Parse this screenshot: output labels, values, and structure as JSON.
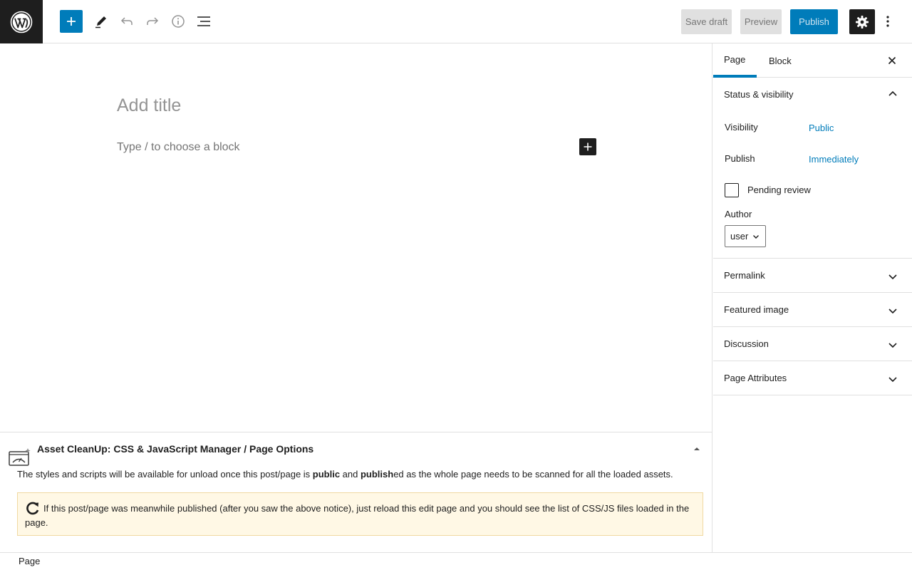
{
  "toolbar": {
    "save_draft_label": "Save draft",
    "preview_label": "Preview",
    "publish_label": "Publish"
  },
  "editor": {
    "title_placeholder": "Add title",
    "block_placeholder": "Type / to choose a block"
  },
  "sidebar": {
    "tabs": [
      {
        "label": "Page",
        "active": true
      },
      {
        "label": "Block",
        "active": false
      }
    ],
    "status_visibility": {
      "heading": "Status & visibility",
      "visibility_label": "Visibility",
      "visibility_value": "Public",
      "publish_label": "Publish",
      "publish_value": "Immediately",
      "pending_review_label": "Pending review",
      "author_label": "Author",
      "author_value": "user"
    },
    "panels": [
      {
        "heading": "Permalink"
      },
      {
        "heading": "Featured image"
      },
      {
        "heading": "Discussion"
      },
      {
        "heading": "Page Attributes"
      }
    ]
  },
  "metabox": {
    "title": "Asset CleanUp: CSS & JavaScript Manager / Page Options",
    "desc_part1": "The styles and scripts will be available for unload once this post/page is ",
    "desc_bold1": "public",
    "desc_part2": " and ",
    "desc_bold2": "publish",
    "desc_part3": "ed as the whole page needs to be scanned for all the loaded assets.",
    "notice_text": "If this post/page was meanwhile published (after you saw the above notice), just reload this edit page and you should see the list of CSS/JS files loaded in the page."
  },
  "footer": {
    "breadcrumb": "Page"
  },
  "colors": {
    "accent": "#007cba",
    "dark": "#1e1e1e",
    "notice_bg": "#fff8e5"
  }
}
